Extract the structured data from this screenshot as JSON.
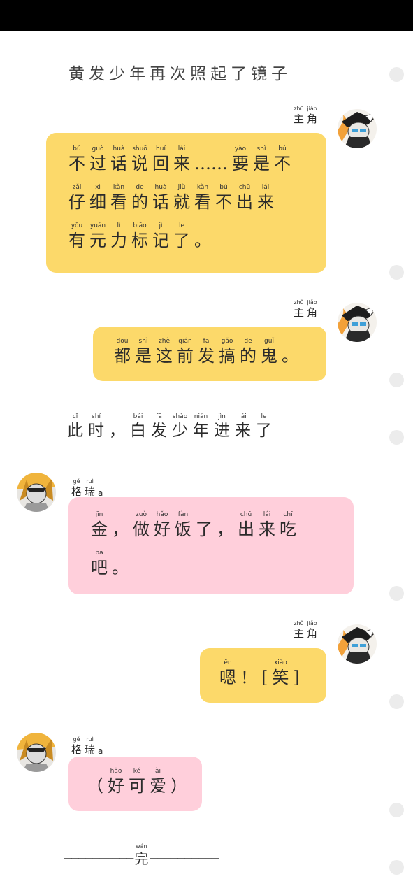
{
  "narration_1": "黄发少年再次照起了镜子",
  "narration_2": [
    {
      "py": "cǐ",
      "hz": "此"
    },
    {
      "py": "shí",
      "hz": "时"
    },
    {
      "py": "",
      "hz": "，"
    },
    {
      "py": "bái",
      "hz": "白"
    },
    {
      "py": "fā",
      "hz": "发"
    },
    {
      "py": "shǎo",
      "hz": "少"
    },
    {
      "py": "nián",
      "hz": "年"
    },
    {
      "py": "jìn",
      "hz": "进"
    },
    {
      "py": "lái",
      "hz": "来"
    },
    {
      "py": "le",
      "hz": "了"
    }
  ],
  "speakers": {
    "protagonist": [
      {
        "py": "zhǔ",
        "hz": "主"
      },
      {
        "py": "jiǎo",
        "hz": "角"
      }
    ],
    "gerui": [
      {
        "py": "gé",
        "hz": "格"
      },
      {
        "py": "ruì",
        "hz": "瑞"
      }
    ],
    "gerui_suffix": "a"
  },
  "messages": {
    "m1": [
      [
        {
          "py": "bú",
          "hz": "不"
        },
        {
          "py": "guò",
          "hz": "过"
        },
        {
          "py": "huà",
          "hz": "话"
        },
        {
          "py": "shuō",
          "hz": "说"
        },
        {
          "py": "huí",
          "hz": "回"
        },
        {
          "py": "lái",
          "hz": "来"
        },
        {
          "py": "",
          "hz": "……"
        },
        {
          "py": "yào",
          "hz": "要"
        },
        {
          "py": "shì",
          "hz": "是"
        },
        {
          "py": "bú",
          "hz": "不"
        }
      ],
      [
        {
          "py": "zǎi",
          "hz": "仔"
        },
        {
          "py": "xì",
          "hz": "细"
        },
        {
          "py": "kàn",
          "hz": "看"
        },
        {
          "py": "de",
          "hz": "的"
        },
        {
          "py": "huà",
          "hz": "话"
        },
        {
          "py": "jiù",
          "hz": "就"
        },
        {
          "py": "kàn",
          "hz": "看"
        },
        {
          "py": "bú",
          "hz": "不"
        },
        {
          "py": "chū",
          "hz": "出"
        },
        {
          "py": "lái",
          "hz": "来"
        }
      ],
      [
        {
          "py": "yǒu",
          "hz": "有"
        },
        {
          "py": "yuán",
          "hz": "元"
        },
        {
          "py": "lì",
          "hz": "力"
        },
        {
          "py": "biāo",
          "hz": "标"
        },
        {
          "py": "jì",
          "hz": "记"
        },
        {
          "py": "le",
          "hz": "了"
        },
        {
          "py": "",
          "hz": "。"
        }
      ]
    ],
    "m2": [
      [
        {
          "py": "dōu",
          "hz": "都"
        },
        {
          "py": "shì",
          "hz": "是"
        },
        {
          "py": "zhè",
          "hz": "这"
        },
        {
          "py": "qián",
          "hz": "前"
        },
        {
          "py": "fā",
          "hz": "发"
        },
        {
          "py": "gǎo",
          "hz": "搞"
        },
        {
          "py": "de",
          "hz": "的"
        },
        {
          "py": "guǐ",
          "hz": "鬼"
        },
        {
          "py": "",
          "hz": "。"
        }
      ]
    ],
    "m3": [
      [
        {
          "py": "jīn",
          "hz": "金"
        },
        {
          "py": "",
          "hz": "，"
        },
        {
          "py": "zuò",
          "hz": "做"
        },
        {
          "py": "hǎo",
          "hz": "好"
        },
        {
          "py": "fàn",
          "hz": "饭"
        },
        {
          "py": "",
          "hz": "了"
        },
        {
          "py": "",
          "hz": "，"
        },
        {
          "py": "chū",
          "hz": "出"
        },
        {
          "py": "lái",
          "hz": "来"
        },
        {
          "py": "chī",
          "hz": "吃"
        }
      ],
      [
        {
          "py": "ba",
          "hz": "吧"
        },
        {
          "py": "",
          "hz": "。"
        }
      ]
    ],
    "m4": [
      [
        {
          "py": "ēn",
          "hz": "嗯"
        },
        {
          "py": "",
          "hz": "！"
        },
        {
          "py": "",
          "hz": "["
        },
        {
          "py": "xiào",
          "hz": "笑"
        },
        {
          "py": "",
          "hz": "]"
        }
      ]
    ],
    "m5": [
      [
        {
          "py": "",
          "hz": "（"
        },
        {
          "py": "hǎo",
          "hz": "好"
        },
        {
          "py": "kě",
          "hz": "可"
        },
        {
          "py": "ài",
          "hz": "爱"
        },
        {
          "py": "",
          "hz": "）"
        }
      ]
    ]
  },
  "ending": {
    "dashes_left": "——————————",
    "word": {
      "py": "wán",
      "hz": "完"
    },
    "dashes_right": "——————————"
  },
  "colors": {
    "yellow_bubble": "#fcd96a",
    "pink_bubble": "#ffcfdb",
    "top_bar": "#000000"
  }
}
